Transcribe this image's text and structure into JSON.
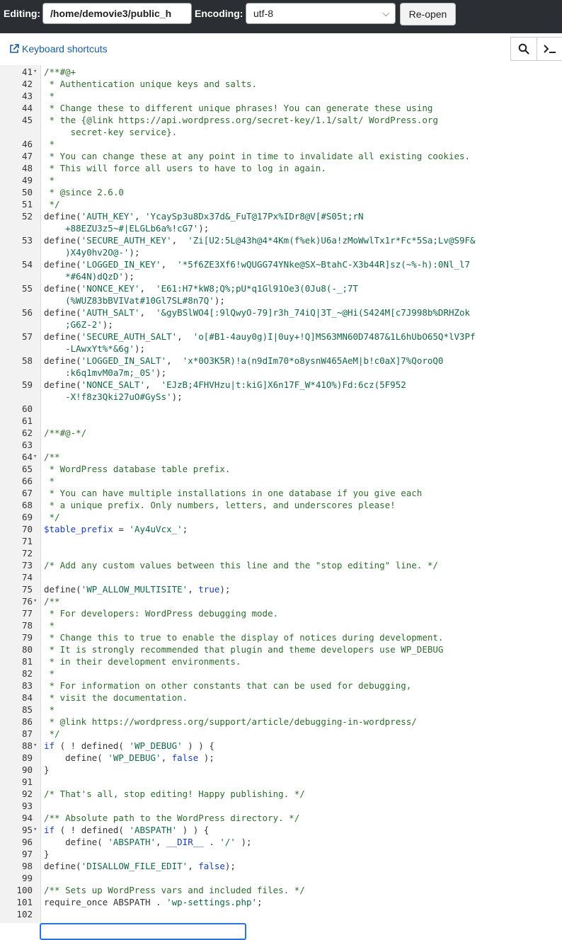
{
  "toolbar": {
    "editing_label": "Editing:",
    "path_value": "/home/demovie3/public_h",
    "encoding_label": "Encoding:",
    "encoding_value": "utf-8",
    "reopen_label": "Re-open"
  },
  "subbar": {
    "keyboard_shortcuts": "Keyboard shortcuts"
  },
  "code": [
    {
      "n": "41",
      "fold": true,
      "parts": [
        [
          "cmt",
          "/**#@+"
        ]
      ]
    },
    {
      "n": "42",
      "parts": [
        [
          "cmt",
          " * Authentication unique keys and salts."
        ]
      ]
    },
    {
      "n": "43",
      "parts": [
        [
          "cmt",
          " *"
        ]
      ]
    },
    {
      "n": "44",
      "parts": [
        [
          "cmt",
          " * Change these to different unique phrases! You can generate these using"
        ]
      ]
    },
    {
      "n": "45",
      "parts": [
        [
          "cmt",
          " * the {@link https://api.wordpress.org/secret-key/1.1/salt/ WordPress.org"
        ]
      ]
    },
    {
      "n": "",
      "parts": [
        [
          "cmt",
          "     secret-key service}."
        ]
      ]
    },
    {
      "n": "46",
      "parts": [
        [
          "cmt",
          " *"
        ]
      ]
    },
    {
      "n": "47",
      "parts": [
        [
          "cmt",
          " * You can change these at any point in time to invalidate all existing cookies."
        ]
      ]
    },
    {
      "n": "48",
      "parts": [
        [
          "cmt",
          " * This will force all users to have to log in again."
        ]
      ]
    },
    {
      "n": "49",
      "parts": [
        [
          "cmt",
          " *"
        ]
      ]
    },
    {
      "n": "50",
      "parts": [
        [
          "cmt",
          " * @since 2.6.0"
        ]
      ]
    },
    {
      "n": "51",
      "parts": [
        [
          "cmt",
          " */"
        ]
      ]
    },
    {
      "n": "52",
      "parts": [
        [
          "",
          "define("
        ],
        [
          "str",
          "'AUTH_KEY'"
        ],
        [
          "",
          ", "
        ],
        [
          "str",
          "'YcaySp3u8Dx37d&_FuT@17Px%IDr8@V[#S05t;rN"
        ]
      ]
    },
    {
      "n": "",
      "parts": [
        [
          "str",
          "    +88EZU3z5~#|ELGLb6a%!cG7'"
        ],
        [
          "",
          ");"
        ]
      ]
    },
    {
      "n": "53",
      "parts": [
        [
          "",
          "define("
        ],
        [
          "str",
          "'SECURE_AUTH_KEY'"
        ],
        [
          "",
          ",  "
        ],
        [
          "str",
          "'Zi[U2:5L@43h@4*4Km(f%ek)U6a!zMoWwlTx1r*Fc*5Sa;Lv@S9F&"
        ]
      ]
    },
    {
      "n": "",
      "parts": [
        [
          "str",
          "    )X4y0hv2O@-'"
        ],
        [
          "",
          ");"
        ]
      ]
    },
    {
      "n": "54",
      "parts": [
        [
          "",
          "define("
        ],
        [
          "str",
          "'LOGGED_IN_KEY'"
        ],
        [
          "",
          ",  "
        ],
        [
          "str",
          "'*5f6ZE3Xf6!wQUGG74YNke@SX~BtahC-X3b44R]sz(~%-h):0Nl_l7"
        ]
      ]
    },
    {
      "n": "",
      "parts": [
        [
          "str",
          "    *#64N)dQzD'"
        ],
        [
          "",
          ");"
        ]
      ]
    },
    {
      "n": "55",
      "parts": [
        [
          "",
          "define("
        ],
        [
          "str",
          "'NONCE_KEY'"
        ],
        [
          "",
          ",  "
        ],
        [
          "str",
          "'E61:H7*kW8;Q%;pU*q1Gl91Oe3(0Ju8(-_;7T"
        ]
      ]
    },
    {
      "n": "",
      "parts": [
        [
          "str",
          "    (%WUZ83bBVIVat#10Gl7SL#8n7Q'"
        ],
        [
          "",
          ");"
        ]
      ]
    },
    {
      "n": "56",
      "parts": [
        [
          "",
          "define("
        ],
        [
          "str",
          "'AUTH_SALT'"
        ],
        [
          "",
          ",  "
        ],
        [
          "str",
          "'&gyBSlWO4[:9lQwyO-79]r3h_74iQ|3T_~@Hi(S424M[c7J998b%DRHZok"
        ]
      ]
    },
    {
      "n": "",
      "parts": [
        [
          "str",
          "    ;G6Z-2'"
        ],
        [
          "",
          ");"
        ]
      ]
    },
    {
      "n": "57",
      "parts": [
        [
          "",
          "define("
        ],
        [
          "str",
          "'SECURE_AUTH_SALT'"
        ],
        [
          "",
          ",  "
        ],
        [
          "str",
          "'o[#B1-4auy0g)I|0uy+!Q]MS63MN60D7487&1L6hUbO65Q*lV3Pf"
        ]
      ]
    },
    {
      "n": "",
      "parts": [
        [
          "str",
          "    -LAwxYt%*&6g'"
        ],
        [
          "",
          ");"
        ]
      ]
    },
    {
      "n": "58",
      "parts": [
        [
          "",
          "define("
        ],
        [
          "str",
          "'LOGGED_IN_SALT'"
        ],
        [
          "",
          ",  "
        ],
        [
          "str",
          "'x*0O3K5R)!a(n9dIm70*o8ysnW465AeM|b!c0aX]7%QoroQ0"
        ]
      ]
    },
    {
      "n": "",
      "parts": [
        [
          "str",
          "    :k6q1mvM0a7m;_0S'"
        ],
        [
          "",
          ");"
        ]
      ]
    },
    {
      "n": "59",
      "parts": [
        [
          "",
          "define("
        ],
        [
          "str",
          "'NONCE_SALT'"
        ],
        [
          "",
          ",  "
        ],
        [
          "str",
          "'EJzB;4FHVHzu|t:kiG]X6n17F_W*41O%)Fd:6cz(5F952"
        ]
      ]
    },
    {
      "n": "",
      "parts": [
        [
          "str",
          "    -X!f8z3Qki27uO#GySs'"
        ],
        [
          "",
          ");"
        ]
      ]
    },
    {
      "n": "60",
      "parts": []
    },
    {
      "n": "61",
      "parts": []
    },
    {
      "n": "62",
      "parts": [
        [
          "cmt",
          "/**#@-*/"
        ]
      ]
    },
    {
      "n": "63",
      "parts": []
    },
    {
      "n": "64",
      "fold": true,
      "parts": [
        [
          "cmt",
          "/**"
        ]
      ]
    },
    {
      "n": "65",
      "parts": [
        [
          "cmt",
          " * WordPress database table prefix."
        ]
      ]
    },
    {
      "n": "66",
      "parts": [
        [
          "cmt",
          " *"
        ]
      ]
    },
    {
      "n": "67",
      "parts": [
        [
          "cmt",
          " * You can have multiple installations in one database if you give each"
        ]
      ]
    },
    {
      "n": "68",
      "parts": [
        [
          "cmt",
          " * a unique prefix. Only numbers, letters, and underscores please!"
        ]
      ]
    },
    {
      "n": "69",
      "parts": [
        [
          "cmt",
          " */"
        ]
      ]
    },
    {
      "n": "70",
      "parts": [
        [
          "var",
          "$table_prefix"
        ],
        [
          "",
          " = "
        ],
        [
          "str",
          "'Ay4uVcx_'"
        ],
        [
          "",
          ";"
        ]
      ]
    },
    {
      "n": "71",
      "parts": []
    },
    {
      "n": "72",
      "parts": []
    },
    {
      "n": "73",
      "parts": [
        [
          "cmt",
          "/* Add any custom values between this line and the \"stop editing\" line. */"
        ]
      ]
    },
    {
      "n": "74",
      "parts": []
    },
    {
      "n": "75",
      "parts": [
        [
          "",
          "define("
        ],
        [
          "str",
          "'WP_ALLOW_MULTISITE'"
        ],
        [
          "",
          ", "
        ],
        [
          "kw",
          "true"
        ],
        [
          "",
          ");"
        ]
      ]
    },
    {
      "n": "76",
      "fold": true,
      "parts": [
        [
          "cmt",
          "/**"
        ]
      ]
    },
    {
      "n": "77",
      "parts": [
        [
          "cmt",
          " * For developers: WordPress debugging mode."
        ]
      ]
    },
    {
      "n": "78",
      "parts": [
        [
          "cmt",
          " *"
        ]
      ]
    },
    {
      "n": "79",
      "parts": [
        [
          "cmt",
          " * Change this to true to enable the display of notices during development."
        ]
      ]
    },
    {
      "n": "80",
      "parts": [
        [
          "cmt",
          " * It is strongly recommended that plugin and theme developers use WP_DEBUG"
        ]
      ]
    },
    {
      "n": "81",
      "parts": [
        [
          "cmt",
          " * in their development environments."
        ]
      ]
    },
    {
      "n": "82",
      "parts": [
        [
          "cmt",
          " *"
        ]
      ]
    },
    {
      "n": "83",
      "parts": [
        [
          "cmt",
          " * For information on other constants that can be used for debugging,"
        ]
      ]
    },
    {
      "n": "84",
      "parts": [
        [
          "cmt",
          " * visit the documentation."
        ]
      ]
    },
    {
      "n": "85",
      "parts": [
        [
          "cmt",
          " *"
        ]
      ]
    },
    {
      "n": "86",
      "parts": [
        [
          "cmt",
          " * @link https://wordpress.org/support/article/debugging-in-wordpress/"
        ]
      ]
    },
    {
      "n": "87",
      "parts": [
        [
          "cmt",
          " */"
        ]
      ]
    },
    {
      "n": "88",
      "fold": true,
      "parts": [
        [
          "kw",
          "if"
        ],
        [
          "",
          " ( ! defined( "
        ],
        [
          "str",
          "'WP_DEBUG'"
        ],
        [
          "",
          " ) ) {"
        ]
      ]
    },
    {
      "n": "89",
      "parts": [
        [
          "",
          "    define( "
        ],
        [
          "str",
          "'WP_DEBUG'"
        ],
        [
          "",
          ", "
        ],
        [
          "kw",
          "false"
        ],
        [
          "",
          " );"
        ]
      ]
    },
    {
      "n": "90",
      "parts": [
        [
          "",
          "}"
        ]
      ]
    },
    {
      "n": "91",
      "parts": []
    },
    {
      "n": "92",
      "parts": [
        [
          "cmt",
          "/* That's all, stop editing! Happy publishing. */"
        ]
      ]
    },
    {
      "n": "93",
      "parts": []
    },
    {
      "n": "94",
      "parts": [
        [
          "cmt",
          "/** Absolute path to the WordPress directory. */"
        ]
      ]
    },
    {
      "n": "95",
      "fold": true,
      "parts": [
        [
          "kw",
          "if"
        ],
        [
          "",
          " ( ! defined( "
        ],
        [
          "str",
          "'ABSPATH'"
        ],
        [
          "",
          " ) ) {"
        ]
      ]
    },
    {
      "n": "96",
      "parts": [
        [
          "",
          "    define( "
        ],
        [
          "str",
          "'ABSPATH'"
        ],
        [
          "",
          ", "
        ],
        [
          "kw",
          "__DIR__"
        ],
        [
          "",
          " . "
        ],
        [
          "str",
          "'/'"
        ],
        [
          "",
          " );"
        ]
      ]
    },
    {
      "n": "97",
      "parts": [
        [
          "",
          "}"
        ]
      ]
    },
    {
      "n": "98",
      "parts": [
        [
          "",
          "define("
        ],
        [
          "str",
          "'DISALLOW_FILE_EDIT'"
        ],
        [
          "",
          ", "
        ],
        [
          "kw",
          "false"
        ],
        [
          "",
          ");"
        ]
      ]
    },
    {
      "n": "99",
      "parts": []
    },
    {
      "n": "100",
      "parts": [
        [
          "cmt",
          "/** Sets up WordPress vars and included files. */"
        ]
      ]
    },
    {
      "n": "101",
      "parts": [
        [
          "",
          "require_once ABSPATH . "
        ],
        [
          "str",
          "'wp-settings.php'"
        ],
        [
          "",
          ";"
        ]
      ]
    },
    {
      "n": "102",
      "parts": []
    }
  ]
}
